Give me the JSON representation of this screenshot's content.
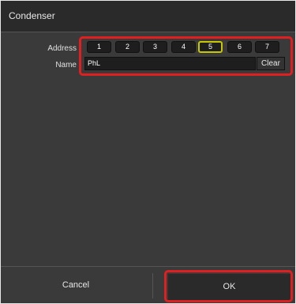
{
  "dialog": {
    "title": "Condenser"
  },
  "form": {
    "address_label": "Address",
    "name_label": "Name",
    "addresses": [
      "1",
      "2",
      "3",
      "4",
      "5",
      "6",
      "7"
    ],
    "selected_address": "5",
    "name_value": "PhL",
    "clear_label": "Clear"
  },
  "footer": {
    "cancel_label": "Cancel",
    "ok_label": "OK"
  },
  "colors": {
    "selected_outline": "#c8c800",
    "highlight": "#e02020"
  }
}
